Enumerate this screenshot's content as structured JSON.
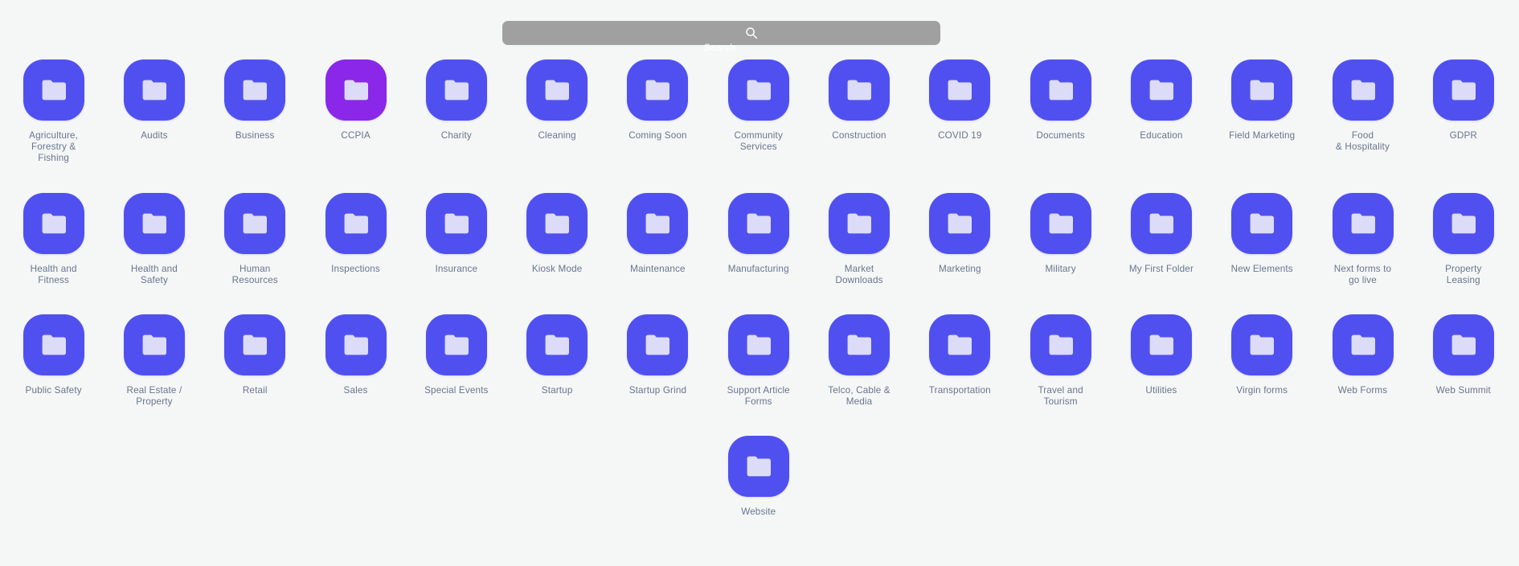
{
  "page": {
    "background_color": "#f5f7f7"
  },
  "search": {
    "value": "",
    "placeholder": "",
    "caption": "Search",
    "icon": "search-icon",
    "background_color": "#a0a0a0"
  },
  "folders": {
    "default_color": "#5050f0",
    "glyph_color": "#dcdcf8",
    "label_color": "#69758c",
    "items": [
      {
        "name": "Agriculture, Forestry & Fishing",
        "lines": [
          "Agriculture,",
          "Forestry &",
          "Fishing"
        ],
        "color": "#5050f0"
      },
      {
        "name": "Audits",
        "lines": [
          "Audits"
        ],
        "color": "#5050f0"
      },
      {
        "name": "Business",
        "lines": [
          "Business"
        ],
        "color": "#5050f0"
      },
      {
        "name": "CCPIA",
        "lines": [
          "CCPIA"
        ],
        "color": "#8b27e8"
      },
      {
        "name": "Charity",
        "lines": [
          "Charity"
        ],
        "color": "#5050f0"
      },
      {
        "name": "Cleaning",
        "lines": [
          "Cleaning"
        ],
        "color": "#5050f0"
      },
      {
        "name": "Coming Soon",
        "lines": [
          "Coming Soon"
        ],
        "color": "#5050f0"
      },
      {
        "name": "Community Services",
        "lines": [
          "Community",
          "Services"
        ],
        "color": "#5050f0"
      },
      {
        "name": "Construction",
        "lines": [
          "Construction"
        ],
        "color": "#5050f0"
      },
      {
        "name": "COVID 19",
        "lines": [
          "COVID 19"
        ],
        "color": "#5050f0"
      },
      {
        "name": "Documents",
        "lines": [
          "Documents"
        ],
        "color": "#5050f0"
      },
      {
        "name": "Education",
        "lines": [
          "Education"
        ],
        "color": "#5050f0"
      },
      {
        "name": "Field Marketing",
        "lines": [
          "Field Marketing"
        ],
        "color": "#5050f0"
      },
      {
        "name": "Food & Hospitality",
        "lines": [
          "Food",
          "& Hospitality"
        ],
        "color": "#5050f0"
      },
      {
        "name": "GDPR",
        "lines": [
          "GDPR"
        ],
        "color": "#5050f0"
      },
      {
        "name": "Health and Fitness",
        "lines": [
          "Health and",
          "Fitness"
        ],
        "color": "#5050f0"
      },
      {
        "name": "Health and Safety",
        "lines": [
          "Health and",
          "Safety"
        ],
        "color": "#5050f0"
      },
      {
        "name": "Human Resources",
        "lines": [
          "Human",
          "Resources"
        ],
        "color": "#5050f0"
      },
      {
        "name": "Inspections",
        "lines": [
          "Inspections"
        ],
        "color": "#5050f0"
      },
      {
        "name": "Insurance",
        "lines": [
          "Insurance"
        ],
        "color": "#5050f0"
      },
      {
        "name": "Kiosk Mode",
        "lines": [
          "Kiosk Mode"
        ],
        "color": "#5050f0"
      },
      {
        "name": "Maintenance",
        "lines": [
          "Maintenance"
        ],
        "color": "#5050f0"
      },
      {
        "name": "Manufacturing",
        "lines": [
          "Manufacturing"
        ],
        "color": "#5050f0"
      },
      {
        "name": "Market Downloads",
        "lines": [
          "Market",
          "Downloads"
        ],
        "color": "#5050f0"
      },
      {
        "name": "Marketing",
        "lines": [
          "Marketing"
        ],
        "color": "#5050f0"
      },
      {
        "name": "Military",
        "lines": [
          "Military"
        ],
        "color": "#5050f0"
      },
      {
        "name": "My First Folder",
        "lines": [
          "My First Folder"
        ],
        "color": "#5050f0"
      },
      {
        "name": "New Elements",
        "lines": [
          "New Elements"
        ],
        "color": "#5050f0"
      },
      {
        "name": "Next forms to go live",
        "lines": [
          "Next forms to",
          "go live"
        ],
        "color": "#5050f0"
      },
      {
        "name": "Property Leasing",
        "lines": [
          "Property",
          "Leasing"
        ],
        "color": "#5050f0"
      },
      {
        "name": "Public Safety",
        "lines": [
          "Public Safety"
        ],
        "color": "#5050f0"
      },
      {
        "name": "Real Estate / Property",
        "lines": [
          "Real Estate /",
          "Property"
        ],
        "color": "#5050f0"
      },
      {
        "name": "Retail",
        "lines": [
          "Retail"
        ],
        "color": "#5050f0"
      },
      {
        "name": "Sales",
        "lines": [
          "Sales"
        ],
        "color": "#5050f0"
      },
      {
        "name": "Special Events",
        "lines": [
          "Special Events"
        ],
        "color": "#5050f0"
      },
      {
        "name": "Startup",
        "lines": [
          "Startup"
        ],
        "color": "#5050f0"
      },
      {
        "name": "Startup Grind",
        "lines": [
          "Startup Grind"
        ],
        "color": "#5050f0"
      },
      {
        "name": "Support Article Forms",
        "lines": [
          "Support Article",
          "Forms"
        ],
        "color": "#5050f0"
      },
      {
        "name": "Telco, Cable & Media",
        "lines": [
          "Telco, Cable &",
          "Media"
        ],
        "color": "#5050f0"
      },
      {
        "name": "Transportation",
        "lines": [
          "Transportation"
        ],
        "color": "#5050f0"
      },
      {
        "name": "Travel and Tourism",
        "lines": [
          "Travel and",
          "Tourism"
        ],
        "color": "#5050f0"
      },
      {
        "name": "Utilities",
        "lines": [
          "Utilities"
        ],
        "color": "#5050f0"
      },
      {
        "name": "Virgin forms",
        "lines": [
          "Virgin forms"
        ],
        "color": "#5050f0"
      },
      {
        "name": "Web Forms",
        "lines": [
          "Web Forms"
        ],
        "color": "#5050f0"
      },
      {
        "name": "Web Summit",
        "lines": [
          "Web Summit"
        ],
        "color": "#5050f0"
      },
      {
        "name": "Website",
        "lines": [
          "Website"
        ],
        "color": "#5050f0"
      }
    ]
  }
}
